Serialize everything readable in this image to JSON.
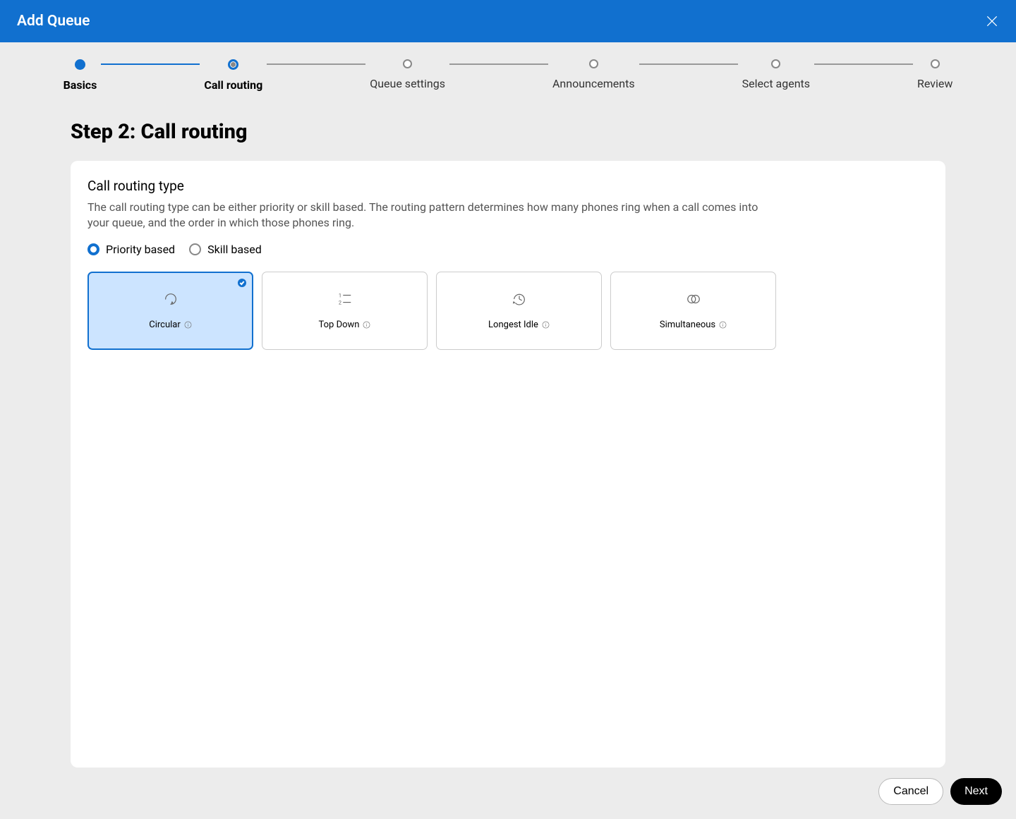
{
  "header": {
    "title": "Add Queue"
  },
  "stepper": {
    "steps": [
      {
        "label": "Basics"
      },
      {
        "label": "Call routing"
      },
      {
        "label": "Queue settings"
      },
      {
        "label": "Announcements"
      },
      {
        "label": "Select agents"
      },
      {
        "label": "Review"
      }
    ]
  },
  "page": {
    "title": "Step 2: Call routing"
  },
  "section": {
    "title": "Call routing type",
    "description": "The call routing type can be either priority or skill based. The routing pattern determines how many phones ring when a call comes into your queue, and the order in which those phones ring."
  },
  "radios": {
    "priority": "Priority based",
    "skill": "Skill based"
  },
  "options": {
    "circular": "Circular",
    "topdown": "Top Down",
    "longestidle": "Longest Idle",
    "simultaneous": "Simultaneous"
  },
  "footer": {
    "cancel": "Cancel",
    "next": "Next"
  }
}
